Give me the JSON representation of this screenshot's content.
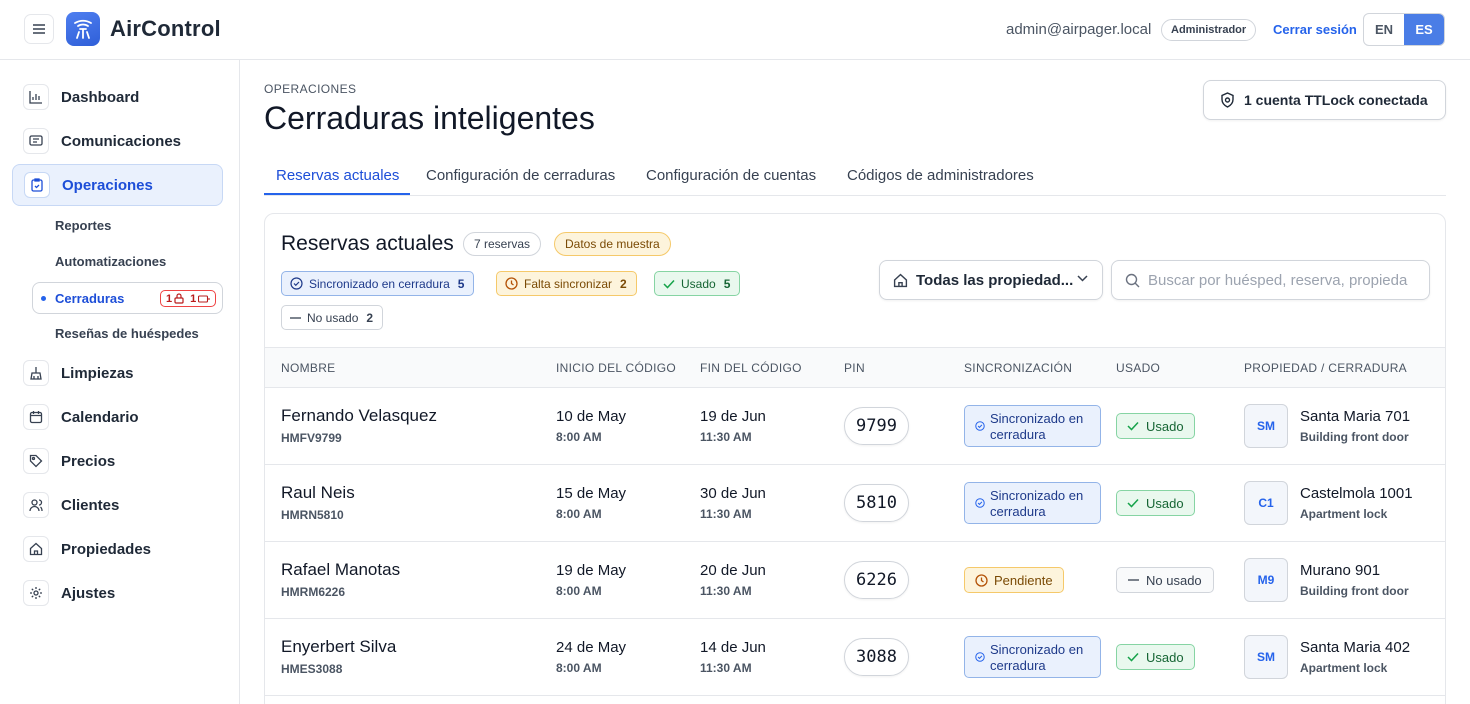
{
  "app": {
    "title": "AirControl"
  },
  "header": {
    "user_email": "admin@airpager.local",
    "role": "Administrador",
    "logout": "Cerrar sesión",
    "languages": [
      {
        "code": "EN",
        "active": false
      },
      {
        "code": "ES",
        "active": true
      }
    ]
  },
  "sidebar": {
    "items": [
      {
        "label": "Dashboard",
        "icon": "bar-chart-icon"
      },
      {
        "label": "Comunicaciones",
        "icon": "message-icon"
      },
      {
        "label": "Operaciones",
        "icon": "clipboard-icon",
        "active": true
      },
      {
        "label": "Limpiezas",
        "icon": "broom-icon"
      },
      {
        "label": "Calendario",
        "icon": "calendar-icon"
      },
      {
        "label": "Precios",
        "icon": "tag-icon"
      },
      {
        "label": "Clientes",
        "icon": "users-icon"
      },
      {
        "label": "Propiedades",
        "icon": "home-icon"
      },
      {
        "label": "Ajustes",
        "icon": "gear-icon"
      }
    ],
    "sub_items": [
      {
        "label": "Reportes"
      },
      {
        "label": "Automatizaciones"
      },
      {
        "label": "Cerraduras",
        "active": true,
        "badge_locked": "1",
        "badge_battery": "1"
      },
      {
        "label": "Reseñas de huéspedes"
      }
    ]
  },
  "page": {
    "eyebrow": "OPERACIONES",
    "title": "Cerraduras inteligentes",
    "ttlock_button": "1 cuenta TTLock conectada",
    "tabs": [
      {
        "label": "Reservas actuales",
        "active": true
      },
      {
        "label": "Configuración de cerraduras"
      },
      {
        "label": "Configuración de cuentas"
      },
      {
        "label": "Códigos de administradores"
      }
    ]
  },
  "reservations": {
    "title": "Reservas actuales",
    "count_label": "7 reservas",
    "sample_label": "Datos de muestra",
    "filters": {
      "synced": {
        "label": "Sincronizado en cerradura",
        "count": "5"
      },
      "missing": {
        "label": "Falta sincronizar",
        "count": "2"
      },
      "used": {
        "label": "Usado",
        "count": "5"
      },
      "unused": {
        "label": "No usado",
        "count": "2"
      }
    },
    "property_select": "Todas las propiedad...",
    "search_placeholder": "Buscar por huésped, reserva, propiedad",
    "columns": [
      "NOMBRE",
      "INICIO DEL CÓDIGO",
      "FIN DEL CÓDIGO",
      "PIN",
      "SINCRONIZACIÓN",
      "USADO",
      "PROPIEDAD / CERRADURA"
    ],
    "rows": [
      {
        "name": "Fernando Velasquez",
        "code": "HMFV9799",
        "start_date": "10 de May",
        "start_time": "8:00 AM",
        "end_date": "19 de Jun",
        "end_time": "11:30 AM",
        "pin": "9799",
        "sync": "synced",
        "sync_label": "Sincronizado en cerradura",
        "used": true,
        "used_label": "Usado",
        "prop_initials": "SM",
        "property": "Santa Maria 701",
        "lock": "Building front door"
      },
      {
        "name": "Raul Neis",
        "code": "HMRN5810",
        "start_date": "15 de May",
        "start_time": "8:00 AM",
        "end_date": "30 de Jun",
        "end_time": "11:30 AM",
        "pin": "5810",
        "sync": "synced",
        "sync_label": "Sincronizado en cerradura",
        "used": true,
        "used_label": "Usado",
        "prop_initials": "C1",
        "property": "Castelmola 1001",
        "lock": "Apartment lock"
      },
      {
        "name": "Rafael Manotas",
        "code": "HMRM6226",
        "start_date": "19 de May",
        "start_time": "8:00 AM",
        "end_date": "20 de Jun",
        "end_time": "11:30 AM",
        "pin": "6226",
        "sync": "pending",
        "sync_label": "Pendiente",
        "used": false,
        "used_label": "No usado",
        "prop_initials": "M9",
        "property": "Murano 901",
        "lock": "Building front door"
      },
      {
        "name": "Enyerbert Silva",
        "code": "HMES3088",
        "start_date": "24 de May",
        "start_time": "8:00 AM",
        "end_date": "14 de Jun",
        "end_time": "11:30 AM",
        "pin": "3088",
        "sync": "synced",
        "sync_label": "Sincronizado en cerradura",
        "used": true,
        "used_label": "Usado",
        "prop_initials": "SM",
        "property": "Santa Maria 402",
        "lock": "Apartment lock"
      }
    ]
  }
}
